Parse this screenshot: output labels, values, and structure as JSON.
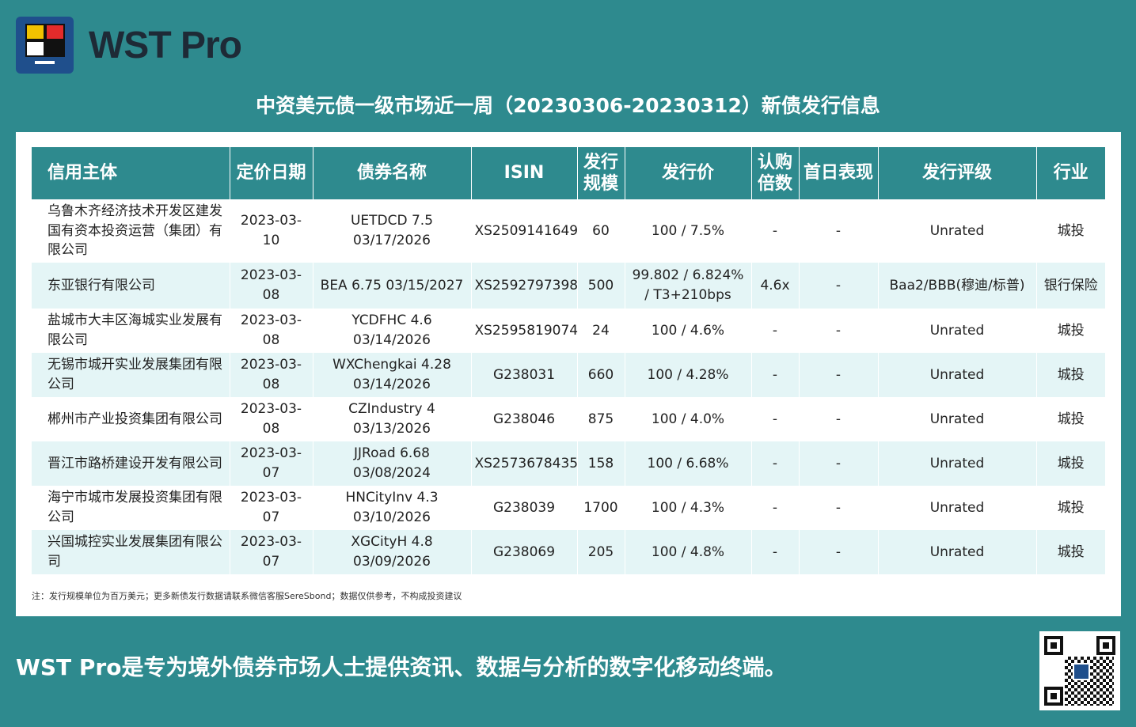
{
  "brand": "WST Pro",
  "title": "中资美元债一级市场近一周（20230306-20230312）新债发行信息",
  "columns": [
    "信用主体",
    "定价日期",
    "债券名称",
    "ISIN",
    "发行规模",
    "发行价",
    "认购倍数",
    "首日表现",
    "发行评级",
    "行业"
  ],
  "rows": [
    {
      "issuer": "乌鲁木齐经济技术开发区建发国有资本投资运营（集团）有限公司",
      "date": "2023-03-10",
      "bond": "UETDCD 7.5 03/17/2026",
      "isin": "XS2509141649",
      "size": "60",
      "price": "100 / 7.5%",
      "cover": "-",
      "first_day": "-",
      "rating": "Unrated",
      "industry": "城投"
    },
    {
      "issuer": "东亚银行有限公司",
      "date": "2023-03-08",
      "bond": "BEA 6.75 03/15/2027",
      "isin": "XS2592797398",
      "size": "500",
      "price": "99.802 / 6.824% / T3+210bps",
      "cover": "4.6x",
      "first_day": "-",
      "rating": "Baa2/BBB(穆迪/标普)",
      "industry": "银行保险"
    },
    {
      "issuer": "盐城市大丰区海城实业发展有限公司",
      "date": "2023-03-08",
      "bond": "YCDFHC 4.6 03/14/2026",
      "isin": "XS2595819074",
      "size": "24",
      "price": "100 / 4.6%",
      "cover": "-",
      "first_day": "-",
      "rating": "Unrated",
      "industry": "城投"
    },
    {
      "issuer": "无锡市城开实业发展集团有限公司",
      "date": "2023-03-08",
      "bond": "WXChengkai 4.28 03/14/2026",
      "isin": "G238031",
      "size": "660",
      "price": "100 / 4.28%",
      "cover": "-",
      "first_day": "-",
      "rating": "Unrated",
      "industry": "城投"
    },
    {
      "issuer": "郴州市产业投资集团有限公司",
      "date": "2023-03-08",
      "bond": "CZIndustry 4 03/13/2026",
      "isin": "G238046",
      "size": "875",
      "price": "100 / 4.0%",
      "cover": "-",
      "first_day": "-",
      "rating": "Unrated",
      "industry": "城投"
    },
    {
      "issuer": "晋江市路桥建设开发有限公司",
      "date": "2023-03-07",
      "bond": "JJRoad 6.68 03/08/2024",
      "isin": "XS2573678435",
      "size": "158",
      "price": "100 / 6.68%",
      "cover": "-",
      "first_day": "-",
      "rating": "Unrated",
      "industry": "城投"
    },
    {
      "issuer": "海宁市城市发展投资集团有限公司",
      "date": "2023-03-07",
      "bond": "HNCityInv 4.3 03/10/2026",
      "isin": "G238039",
      "size": "1700",
      "price": "100 / 4.3%",
      "cover": "-",
      "first_day": "-",
      "rating": "Unrated",
      "industry": "城投"
    },
    {
      "issuer": "兴国城控实业发展集团有限公司",
      "date": "2023-03-07",
      "bond": "XGCityH 4.8 03/09/2026",
      "isin": "G238069",
      "size": "205",
      "price": "100 / 4.8%",
      "cover": "-",
      "first_day": "-",
      "rating": "Unrated",
      "industry": "城投"
    }
  ],
  "note": "注：发行规模单位为百万美元；更多新债发行数据请联系微信客服SereSbond；数据仅供参考，不构成投资建议",
  "watermark": "WST Pro",
  "tagline": "WST Pro是专为境外债券市场人士提供资讯、数据与分析的数字化移动终端。",
  "colors": {
    "teal": "#2e8a8e",
    "row_alt": "#e4f5f6",
    "logo_bg": "#1f4f8c"
  },
  "icons": {
    "logo": "wst-pro-logo-icon",
    "qr": "qr-code-icon"
  }
}
